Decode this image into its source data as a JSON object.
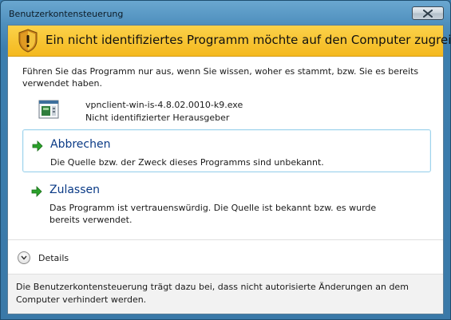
{
  "window": {
    "title": "Benutzerkontensteuerung"
  },
  "banner": {
    "title": "Ein nicht identifiziertes Programm möchte auf den Computer zugreifen",
    "icon": "uac-shield-icon"
  },
  "intro": {
    "text": "Führen Sie das Programm nur aus, wenn Sie wissen, woher es stammt, bzw. Sie es bereits verwendet haben."
  },
  "program": {
    "name": "vpnclient-win-is-4.8.02.0010-k9.exe",
    "publisher": "Nicht identifizierter Herausgeber",
    "icon": "installer-icon"
  },
  "choices": [
    {
      "title": "Abbrechen",
      "description": "Die Quelle bzw. der Zweck dieses Programms sind unbekannt.",
      "icon": "green-arrow-icon",
      "selected": true
    },
    {
      "title": "Zulassen",
      "description": "Das Programm ist vertrauenswürdig. Die Quelle ist bekannt bzw. es wurde bereits verwendet.",
      "icon": "green-arrow-icon",
      "selected": false
    }
  ],
  "details": {
    "label": "Details",
    "icon": "chevron-down-icon"
  },
  "footer": {
    "text": "Die Benutzerkontensteuerung trägt dazu bei, dass nicht autorisierte Änderungen an dem Computer verhindert werden."
  },
  "colors": {
    "banner": "#f4b81e",
    "choice_title": "#0a3a86",
    "arrow": "#2aa12a",
    "selected_border": "#9fd3ec"
  }
}
